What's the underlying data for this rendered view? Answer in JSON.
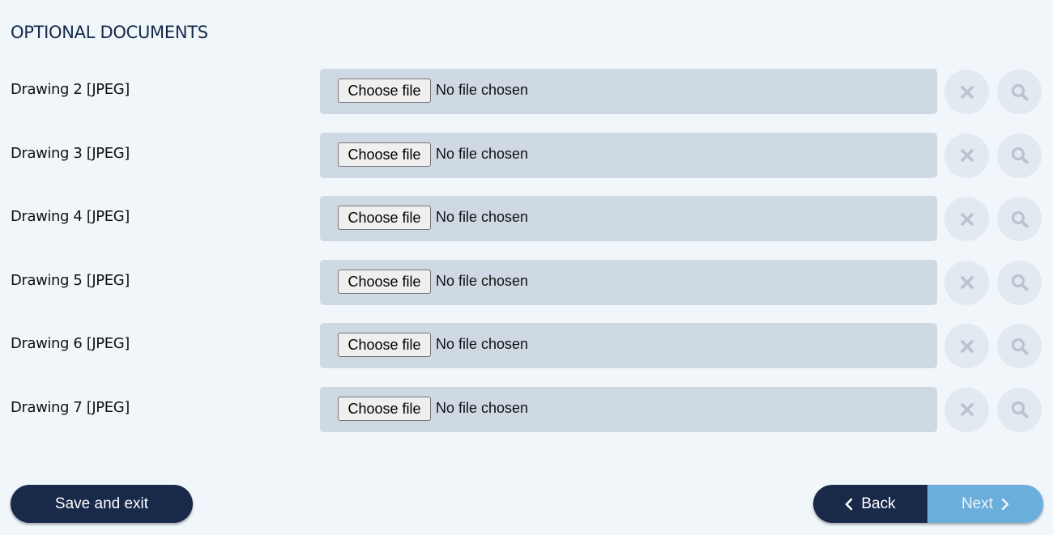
{
  "section": {
    "title": "OPTIONAL DOCUMENTS"
  },
  "documents": [
    {
      "label": "Drawing 2 [JPEG]",
      "button": "Choose file",
      "status": "No file chosen"
    },
    {
      "label": "Drawing 3 [JPEG]",
      "button": "Choose file",
      "status": "No file chosen"
    },
    {
      "label": "Drawing 4 [JPEG]",
      "button": "Choose file",
      "status": "No file chosen"
    },
    {
      "label": "Drawing 5 [JPEG]",
      "button": "Choose file",
      "status": "No file chosen"
    },
    {
      "label": "Drawing 6 [JPEG]",
      "button": "Choose file",
      "status": "No file chosen"
    },
    {
      "label": "Drawing 7 [JPEG]",
      "button": "Choose file",
      "status": "No file chosen"
    }
  ],
  "icons": {
    "clear": "close-icon",
    "view": "search-icon",
    "back": "chevron-left-icon",
    "next": "chevron-right-icon"
  },
  "footer": {
    "save_label": "Save and exit",
    "back_label": "Back",
    "next_label": "Next"
  },
  "colors": {
    "background": "#f1f6fb",
    "title": "#152a4a",
    "file_box": "#cfd9e3",
    "icon_button_bg": "#e2e9f1",
    "icon_color": "#b8c4d2",
    "primary_dark": "#19294a",
    "next_accent": "#6aaedb"
  }
}
